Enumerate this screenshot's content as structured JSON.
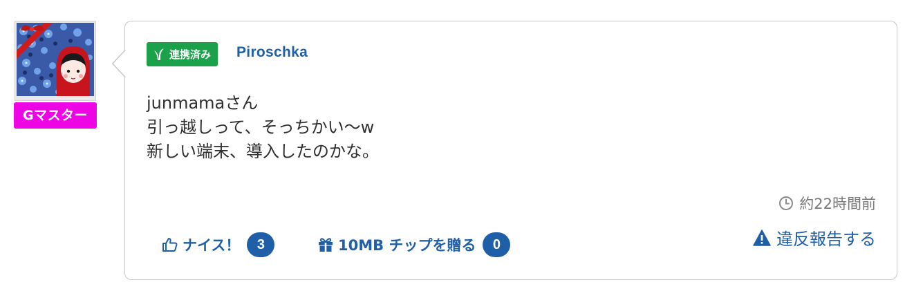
{
  "author": {
    "rank_label": "Gマスター",
    "linked_label": "連携済み",
    "username": "Piroschka"
  },
  "message": {
    "lines": [
      "junmamaさん",
      "引っ越しって、そっちかい〜w",
      "新しい端末、導入したのかな。"
    ]
  },
  "meta": {
    "timestamp": "約22時間前"
  },
  "actions": {
    "nice_label": "ナイス！",
    "nice_count": "3",
    "tip_label": "10MB チップを贈る",
    "tip_count": "0",
    "report_label": "違反報告する"
  },
  "icons": {
    "linked": "leaf-icon",
    "clock": "clock-icon",
    "nice": "thumbs-up-icon",
    "tip": "gift-icon",
    "report": "warning-icon"
  },
  "colors": {
    "link_blue": "#1f5fa8",
    "linked_green": "#1aa149",
    "rank_magenta": "#ee05e4",
    "text": "#2f2f2f",
    "muted": "#7a7a7a"
  }
}
